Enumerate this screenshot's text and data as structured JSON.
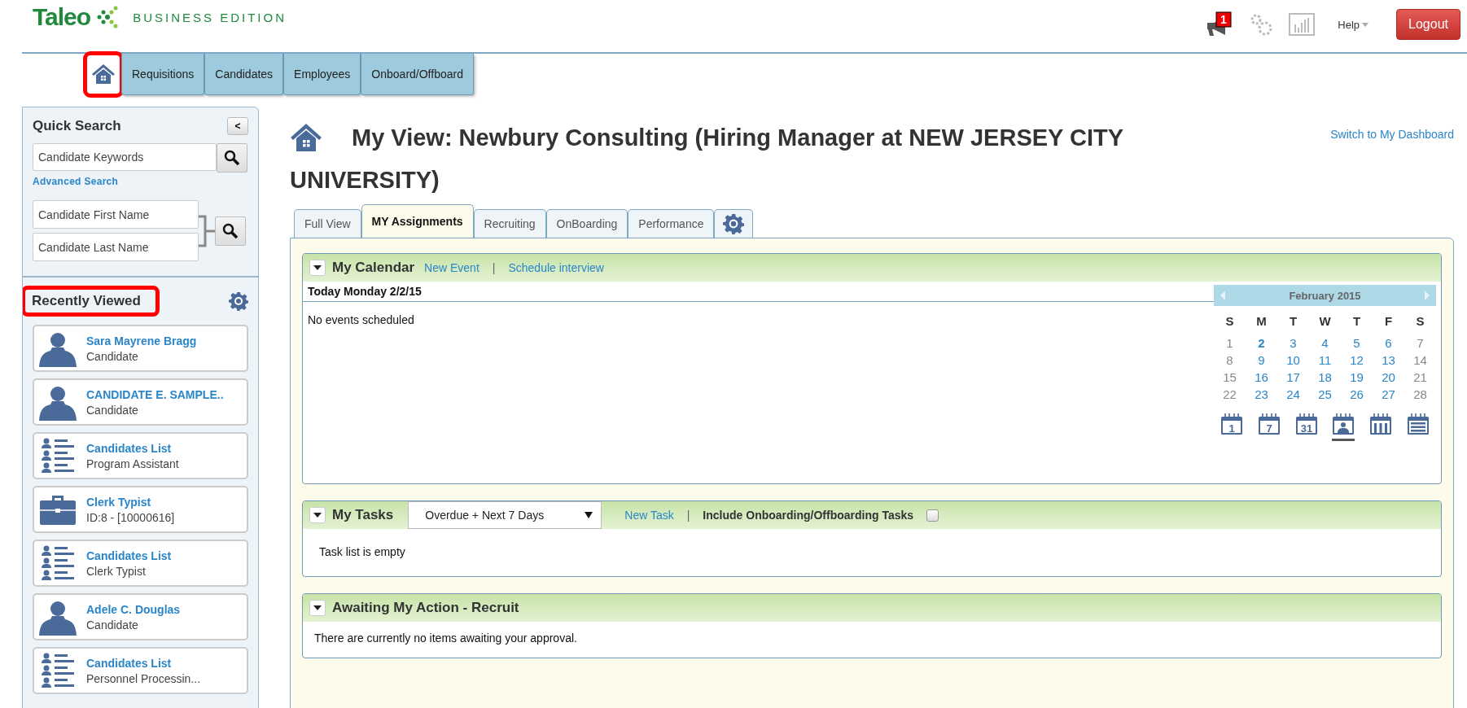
{
  "header": {
    "logo": {
      "name": "Taleo",
      "edition": "BUSINESS EDITION"
    },
    "notification_count": "1",
    "help": "Help",
    "logout": "Logout"
  },
  "nav": [
    {
      "kind": "home",
      "selected": true,
      "highlighted": true
    },
    {
      "kind": "text",
      "label": "Requisitions",
      "selected": false,
      "highlighted": false
    },
    {
      "kind": "text",
      "label": "Candidates",
      "selected": false,
      "highlighted": false
    },
    {
      "kind": "text",
      "label": "Employees",
      "selected": false,
      "highlighted": false
    },
    {
      "kind": "text",
      "label": "Onboard/Offboard",
      "selected": false,
      "highlighted": false
    }
  ],
  "sidebar": {
    "quick_search": {
      "title": "Quick Search",
      "collapse": "<",
      "keywords_placeholder": "Candidate Keywords",
      "advanced": "Advanced Search",
      "first_name_placeholder": "Candidate First Name",
      "last_name_placeholder": "Candidate Last Name"
    },
    "recently_viewed": {
      "title": "Recently Viewed",
      "highlighted": true,
      "items": [
        {
          "kind": "person",
          "title": "Sara Mayrene Bragg",
          "subtitle": "Candidate"
        },
        {
          "kind": "person",
          "title": "CANDIDATE E. SAMPLE..",
          "subtitle": "Candidate"
        },
        {
          "kind": "list",
          "title": "Candidates List",
          "subtitle": "Program Assistant"
        },
        {
          "kind": "job",
          "title": "Clerk Typist",
          "subtitle": "ID:8 - [10000616]"
        },
        {
          "kind": "list",
          "title": "Candidates List",
          "subtitle": "Clerk Typist"
        },
        {
          "kind": "person",
          "title": "Adele C. Douglas",
          "subtitle": "Candidate"
        },
        {
          "kind": "list",
          "title": "Candidates List",
          "subtitle": "Personnel Processin..."
        }
      ]
    }
  },
  "page": {
    "title_lines": [
      "My View: Newbury Consulting (Hiring Manager at NEW JERSEY CITY",
      "UNIVERSITY)"
    ],
    "switch_link": "Switch to My Dashboard"
  },
  "tabs": [
    {
      "kind": "text",
      "label": "Full View",
      "selected": false
    },
    {
      "kind": "text",
      "label": "MY Assignments",
      "selected": true
    },
    {
      "kind": "text",
      "label": "Recruiting",
      "selected": false
    },
    {
      "kind": "text",
      "label": "OnBoarding",
      "selected": false
    },
    {
      "kind": "text",
      "label": "Performance",
      "selected": false
    },
    {
      "kind": "settings",
      "selected": false
    }
  ],
  "calendar": {
    "title": "My Calendar",
    "new_event": "New Event",
    "separator": "|",
    "schedule": "Schedule interview",
    "today_label": "Today Monday 2/2/15",
    "empty": "No events scheduled",
    "month": "February 2015",
    "weekdays": [
      "S",
      "M",
      "T",
      "W",
      "T",
      "F",
      "S"
    ],
    "weeks": [
      [
        {
          "day": "1",
          "today": false
        },
        {
          "day": "2",
          "today": true
        },
        {
          "day": "3",
          "today": false
        },
        {
          "day": "4",
          "today": false
        },
        {
          "day": "5",
          "today": false
        },
        {
          "day": "6",
          "today": false
        },
        {
          "day": "7",
          "today": false
        }
      ],
      [
        {
          "day": "8",
          "today": false
        },
        {
          "day": "9",
          "today": false
        },
        {
          "day": "10",
          "today": false
        },
        {
          "day": "11",
          "today": false
        },
        {
          "day": "12",
          "today": false
        },
        {
          "day": "13",
          "today": false
        },
        {
          "day": "14",
          "today": false
        }
      ],
      [
        {
          "day": "15",
          "today": false
        },
        {
          "day": "16",
          "today": false
        },
        {
          "day": "17",
          "today": false
        },
        {
          "day": "18",
          "today": false
        },
        {
          "day": "19",
          "today": false
        },
        {
          "day": "20",
          "today": false
        },
        {
          "day": "21",
          "today": false
        }
      ],
      [
        {
          "day": "22",
          "today": false
        },
        {
          "day": "23",
          "today": false
        },
        {
          "day": "24",
          "today": false
        },
        {
          "day": "25",
          "today": false
        },
        {
          "day": "26",
          "today": false
        },
        {
          "day": "27",
          "today": false
        },
        {
          "day": "28",
          "today": false
        }
      ]
    ],
    "views": [
      {
        "kind": "number",
        "label": "1",
        "selected": false
      },
      {
        "kind": "number",
        "label": "7",
        "selected": false
      },
      {
        "kind": "number",
        "label": "31",
        "selected": false
      },
      {
        "kind": "person",
        "selected": true
      },
      {
        "kind": "group",
        "selected": false
      },
      {
        "kind": "list",
        "selected": false
      }
    ]
  },
  "tasks": {
    "title": "My Tasks",
    "filter": "Overdue + Next 7 Days",
    "new_task": "New Task",
    "separator": "|",
    "include_label": "Include Onboarding/Offboarding Tasks",
    "include_checked": false,
    "empty": "Task list is empty"
  },
  "awaiting": {
    "title": "Awaiting My Action - Recruit",
    "empty": "There are currently no items awaiting your approval."
  }
}
